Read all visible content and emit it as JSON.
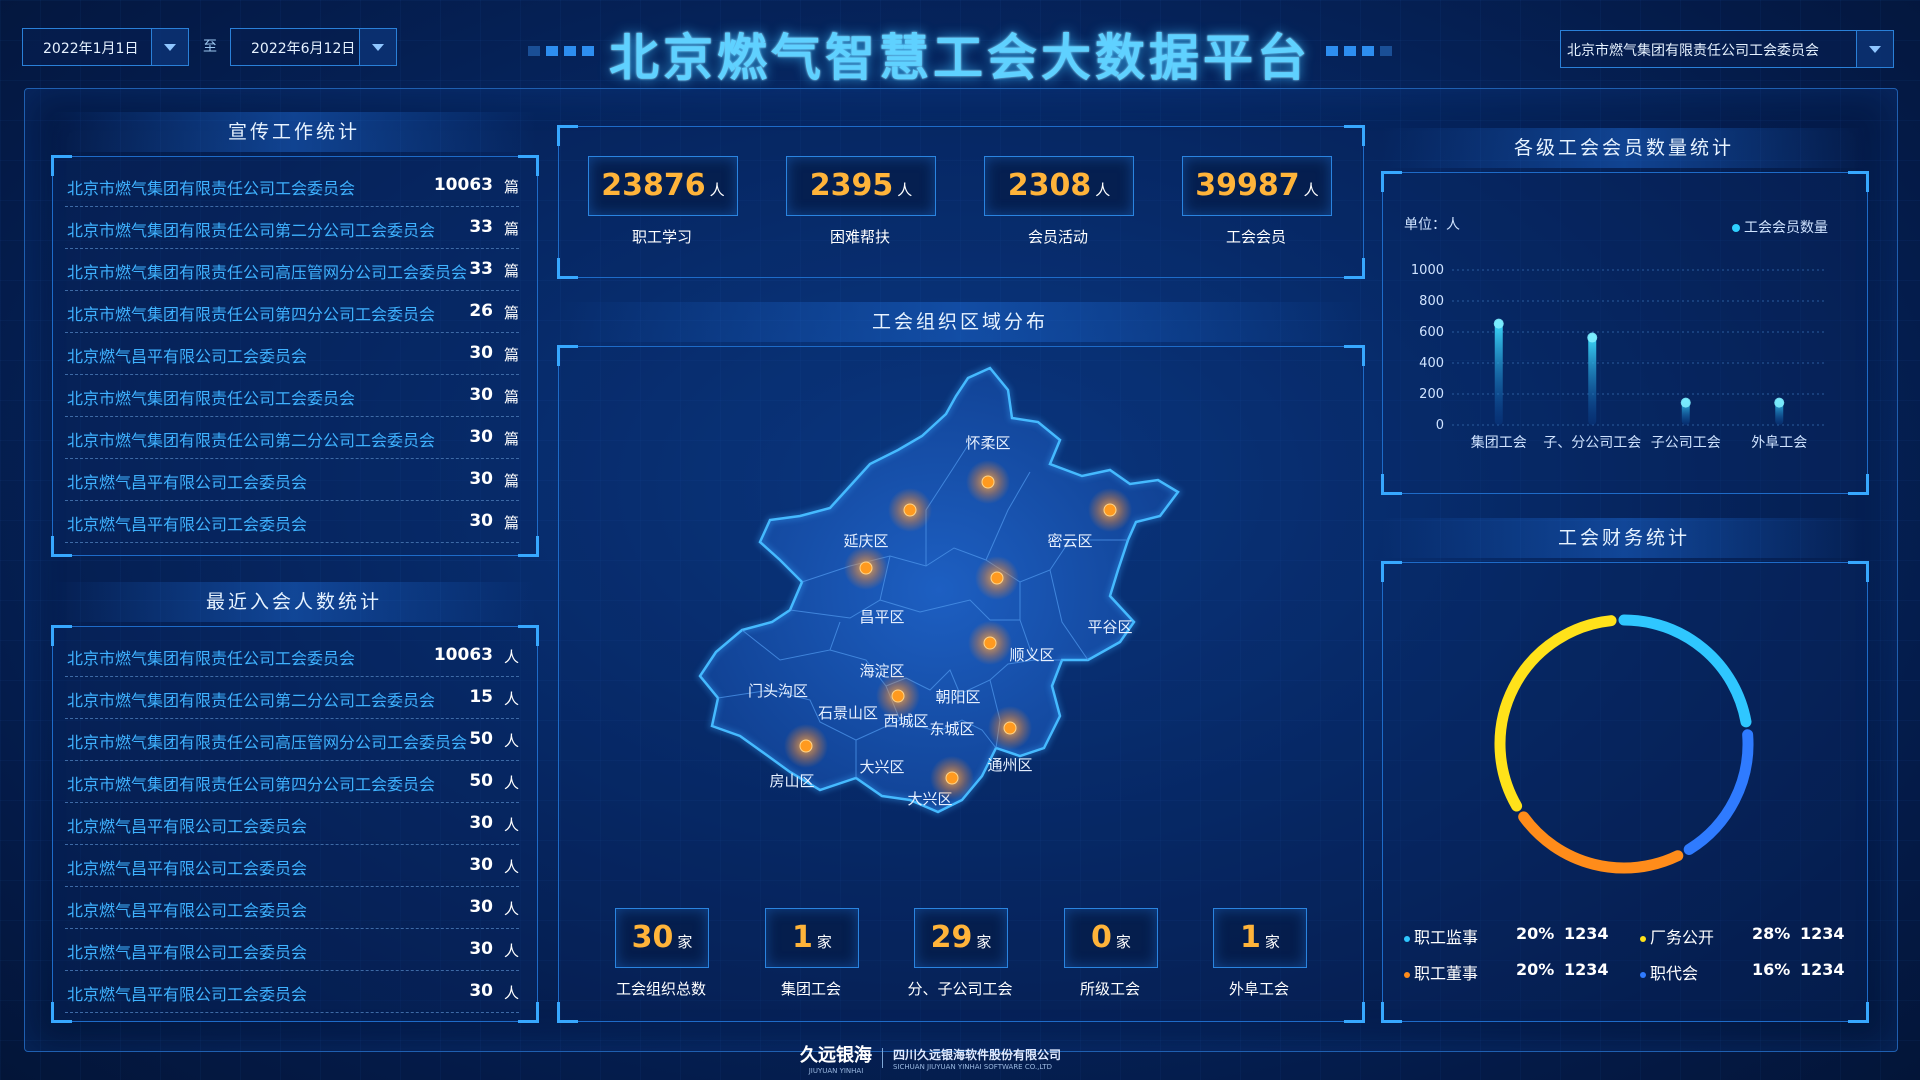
{
  "header": {
    "title": "北京燃气智慧工会大数据平台",
    "date_start": "2022年1月1日",
    "date_separator": "至",
    "date_end": "2022年6月12日",
    "org_selected": "北京市燃气集团有限责任公司工会委员会"
  },
  "publicity": {
    "title": "宣传工作统计",
    "unit": "篇",
    "rows": [
      {
        "name": "北京市燃气集团有限责任公司工会委员会",
        "value": "10063"
      },
      {
        "name": "北京市燃气集团有限责任公司第二分公司工会委员会",
        "value": "33"
      },
      {
        "name": "北京市燃气集团有限责任公司高压管网分公司工会委员会",
        "value": "33"
      },
      {
        "name": "北京市燃气集团有限责任公司第四分公司工会委员会",
        "value": "26"
      },
      {
        "name": "北京燃气昌平有限公司工会委员会",
        "value": "30"
      },
      {
        "name": "北京市燃气集团有限责任公司工会委员会",
        "value": "30"
      },
      {
        "name": "北京市燃气集团有限责任公司第二分公司工会委员会",
        "value": "30"
      },
      {
        "name": "北京燃气昌平有限公司工会委员会",
        "value": "30"
      },
      {
        "name": "北京燃气昌平有限公司工会委员会",
        "value": "30"
      }
    ]
  },
  "recent_members": {
    "title": "最近入会人数统计",
    "unit": "人",
    "rows": [
      {
        "name": "北京市燃气集团有限责任公司工会委员会",
        "value": "10063"
      },
      {
        "name": "北京市燃气集团有限责任公司第二分公司工会委员会",
        "value": "15"
      },
      {
        "name": "北京市燃气集团有限责任公司高压管网分公司工会委员会",
        "value": "50"
      },
      {
        "name": "北京市燃气集团有限责任公司第四分公司工会委员会",
        "value": "50"
      },
      {
        "name": "北京燃气昌平有限公司工会委员会",
        "value": "30"
      },
      {
        "name": "北京燃气昌平有限公司工会委员会",
        "value": "30"
      },
      {
        "name": "北京燃气昌平有限公司工会委员会",
        "value": "30"
      },
      {
        "name": "北京燃气昌平有限公司工会委员会",
        "value": "30"
      },
      {
        "name": "北京燃气昌平有限公司工会委员会",
        "value": "30"
      }
    ]
  },
  "top_stats": {
    "unit": "人",
    "items": [
      {
        "value": "23876",
        "label": "职工学习"
      },
      {
        "value": "2395",
        "label": "困难帮扶"
      },
      {
        "value": "2308",
        "label": "会员活动"
      },
      {
        "value": "39987",
        "label": "工会会员"
      }
    ]
  },
  "map": {
    "title": "工会组织区域分布",
    "districts": [
      "怀柔区",
      "延庆区",
      "密云区",
      "昌平区",
      "平谷区",
      "顺义区",
      "海淀区",
      "门头沟区",
      "朝阳区",
      "石景山区",
      "西城区",
      "东城区",
      "房山区",
      "大兴区",
      "通州区",
      "大兴区"
    ]
  },
  "org_stats": {
    "unit": "家",
    "items": [
      {
        "value": "30",
        "label": "工会组织总数"
      },
      {
        "value": "1",
        "label": "集团工会"
      },
      {
        "value": "29",
        "label": "分、子公司工会"
      },
      {
        "value": "0",
        "label": "所级工会"
      },
      {
        "value": "1",
        "label": "外阜工会"
      }
    ]
  },
  "member_chart": {
    "title": "各级工会会员数量统计",
    "unit_label": "单位：人",
    "legend": "工会会员数量"
  },
  "finance": {
    "title": "工会财务统计",
    "legend": [
      {
        "name": "职工监事",
        "pct": "20%",
        "count": "1234",
        "color": "#2fc7ff"
      },
      {
        "name": "厂务公开",
        "pct": "28%",
        "count": "1234",
        "color": "#ffe21a"
      },
      {
        "name": "职工董事",
        "pct": "20%",
        "count": "1234",
        "color": "#ff8c1a"
      },
      {
        "name": "职代会",
        "pct": "16%",
        "count": "1234",
        "color": "#2f7bff"
      }
    ]
  },
  "footer": {
    "brand": "久远银海",
    "brand_en": "JIUYUAN YINHAI",
    "company": "四川久远银海软件股份有限公司",
    "company_en": "SICHUAN JIUYUAN YINHAI SOFTWARE CO.,LTD"
  },
  "chart_data": [
    {
      "type": "bar",
      "title": "各级工会会员数量统计",
      "ylabel": "单位：人",
      "categories": [
        "集团工会",
        "子、分公司工会",
        "子公司工会",
        "外阜工会"
      ],
      "series": [
        {
          "name": "工会会员数量",
          "values": [
            680,
            590,
            170,
            170
          ]
        }
      ],
      "ylim": [
        0,
        1000
      ],
      "yticks": [
        0,
        200,
        400,
        600,
        800,
        1000
      ],
      "grid": true,
      "legend": "top-right"
    },
    {
      "type": "pie",
      "title": "工会财务统计",
      "categories": [
        "职工监事",
        "职代会",
        "职工董事",
        "厂务公开"
      ],
      "values": [
        20,
        16,
        20,
        28
      ],
      "colors": [
        "#2fc7ff",
        "#2f7bff",
        "#ff8c1a",
        "#ffe21a"
      ],
      "legend": "bottom"
    }
  ]
}
